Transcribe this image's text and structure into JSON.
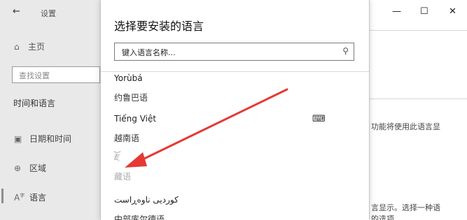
{
  "window": {
    "back_glyph": "←",
    "title": "设置",
    "controls": {
      "minimize": "—",
      "maximize": "☐",
      "close": "✕"
    }
  },
  "sidebar": {
    "home": {
      "icon": "home-icon",
      "label": "主页"
    },
    "search": {
      "placeholder": "查找设置"
    },
    "section_title": "时间和语言",
    "items": [
      {
        "icon": "calendar-icon",
        "label": "日期和时间"
      },
      {
        "icon": "region-icon",
        "label": "区域"
      },
      {
        "icon": "language-icon",
        "label": "语言"
      }
    ]
  },
  "main_partial": {
    "line1": "功能将使用此语言显",
    "line2": "言显示。选择一种语",
    "line3": "的选项"
  },
  "dialog": {
    "title": "选择要安装的语言",
    "search": {
      "placeholder": "键入语言名称..."
    },
    "languages": [
      {
        "native": "Yorùbá",
        "local": "约鲁巴语",
        "disabled": false
      },
      {
        "native": "Tiếng Việt",
        "local": "越南语",
        "disabled": false
      },
      {
        "native": "རྫོ",
        "local": "藏语",
        "disabled": true
      },
      {
        "native": "کوردیی ناوەڕاست",
        "local": "中部库尔德语",
        "disabled": false
      }
    ]
  },
  "annotation": {
    "arrow_color": "#e53935"
  }
}
